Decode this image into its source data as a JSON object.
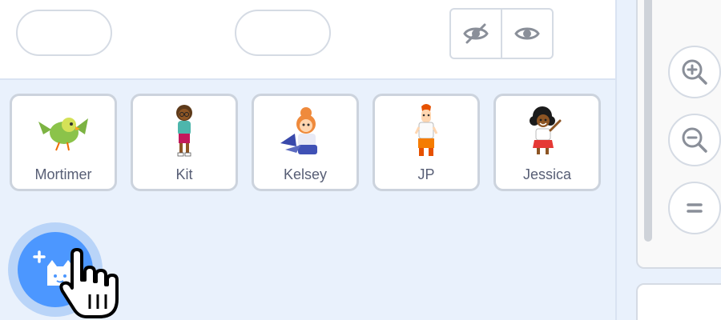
{
  "sprites": [
    {
      "name": "Mortimer",
      "icon": "parrot"
    },
    {
      "name": "Kit",
      "icon": "girl-glasses"
    },
    {
      "name": "Kelsey",
      "icon": "girl-cape"
    },
    {
      "name": "JP",
      "icon": "boy"
    },
    {
      "name": "Jessica",
      "icon": "girl-curly"
    }
  ],
  "visibility": {
    "hide_icon": "eye-slash-icon",
    "show_icon": "eye-icon"
  },
  "zoom": {
    "in_icon": "zoom-in-icon",
    "out_icon": "zoom-out-icon",
    "reset_icon": "zoom-reset-icon"
  },
  "add_sprite": {
    "icon": "cat-add-icon"
  },
  "colors": {
    "accent": "#4c97ff",
    "panel": "#e9f1fc",
    "text": "#575e75",
    "border": "#ccd3dd"
  }
}
